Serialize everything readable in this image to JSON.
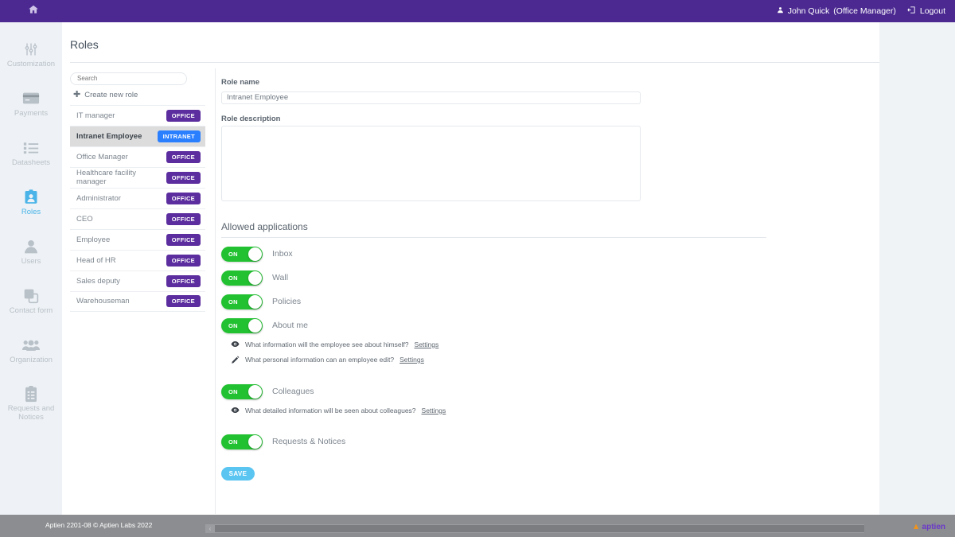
{
  "topbar": {
    "home_icon": "home-icon",
    "user_icon": "user-icon",
    "user_name": "John Quick",
    "user_role": "(Office Manager)",
    "logout_icon": "logout-icon",
    "logout_label": "Logout",
    "background_color": "#4b2991"
  },
  "sidebar": {
    "items": [
      {
        "label": "Customization",
        "icon": "sliders-icon",
        "active": false
      },
      {
        "label": "Payments",
        "icon": "credit-card-icon",
        "active": false
      },
      {
        "label": "Datasheets",
        "icon": "list-icon",
        "active": false
      },
      {
        "label": "Roles",
        "icon": "id-badge-icon",
        "active": true
      },
      {
        "label": "Users",
        "icon": "person-icon",
        "active": false
      },
      {
        "label": "Contact form",
        "icon": "copy-icon",
        "active": false
      },
      {
        "label": "Organization",
        "icon": "people-group-icon",
        "active": false
      },
      {
        "label": "Requests and Notices",
        "icon": "clipboard-icon",
        "active": false
      }
    ],
    "active_color": "#4ab4e8"
  },
  "page": {
    "title": "Roles"
  },
  "roles_panel": {
    "search_placeholder": "Search",
    "search_value": "",
    "create_label": "Create new role",
    "create_icon": "plus-icon",
    "badge_colors": {
      "office": "#5b2d9e",
      "intranet": "#2a7fff"
    },
    "roles": [
      {
        "name": "IT manager",
        "badge": "OFFICE",
        "badge_type": "office",
        "selected": false
      },
      {
        "name": "Intranet Employee",
        "badge": "INTRANET",
        "badge_type": "intranet",
        "selected": true
      },
      {
        "name": "Office Manager",
        "badge": "OFFICE",
        "badge_type": "office",
        "selected": false
      },
      {
        "name": "Healthcare facility manager",
        "badge": "OFFICE",
        "badge_type": "office",
        "selected": false
      },
      {
        "name": "Administrator",
        "badge": "OFFICE",
        "badge_type": "office",
        "selected": false
      },
      {
        "name": "CEO",
        "badge": "OFFICE",
        "badge_type": "office",
        "selected": false
      },
      {
        "name": "Employee",
        "badge": "OFFICE",
        "badge_type": "office",
        "selected": false
      },
      {
        "name": "Head of HR",
        "badge": "OFFICE",
        "badge_type": "office",
        "selected": false
      },
      {
        "name": "Sales deputy",
        "badge": "OFFICE",
        "badge_type": "office",
        "selected": false
      },
      {
        "name": "Warehouseman",
        "badge": "OFFICE",
        "badge_type": "office",
        "selected": false
      }
    ]
  },
  "form": {
    "role_name_label": "Role name",
    "role_name_value": "Intranet Employee",
    "role_name_placeholder": "",
    "role_description_label": "Role description",
    "role_description_value": "",
    "role_description_placeholder": "",
    "section_title": "Allowed applications",
    "save_label": "SAVE",
    "save_color": "#5bc5f2",
    "toggle_on_color": "#22c131",
    "toggle_on_label": "ON",
    "applications": [
      {
        "name": "Inbox",
        "state": "ON",
        "sub_rows": []
      },
      {
        "name": "Wall",
        "state": "ON",
        "sub_rows": []
      },
      {
        "name": "Policies",
        "state": "ON",
        "sub_rows": []
      },
      {
        "name": "About me",
        "state": "ON",
        "sub_rows": [
          {
            "icon": "eye-icon",
            "text": "What information will the employee see about himself?",
            "link": "Settings"
          },
          {
            "icon": "pencil-icon",
            "text": "What personal information can an employee edit?",
            "link": "Settings"
          }
        ]
      },
      {
        "name": "Colleagues",
        "state": "ON",
        "sub_rows": [
          {
            "icon": "eye-icon",
            "text": "What detailed information will be seen about colleagues?",
            "link": "Settings"
          }
        ]
      },
      {
        "name": "Requests & Notices",
        "state": "ON",
        "sub_rows": []
      }
    ]
  },
  "footer": {
    "copyright": "Aptien 2201-08 © Aptien Labs 2022",
    "scroll_arrow": "‹",
    "brand_text": "aptien"
  }
}
